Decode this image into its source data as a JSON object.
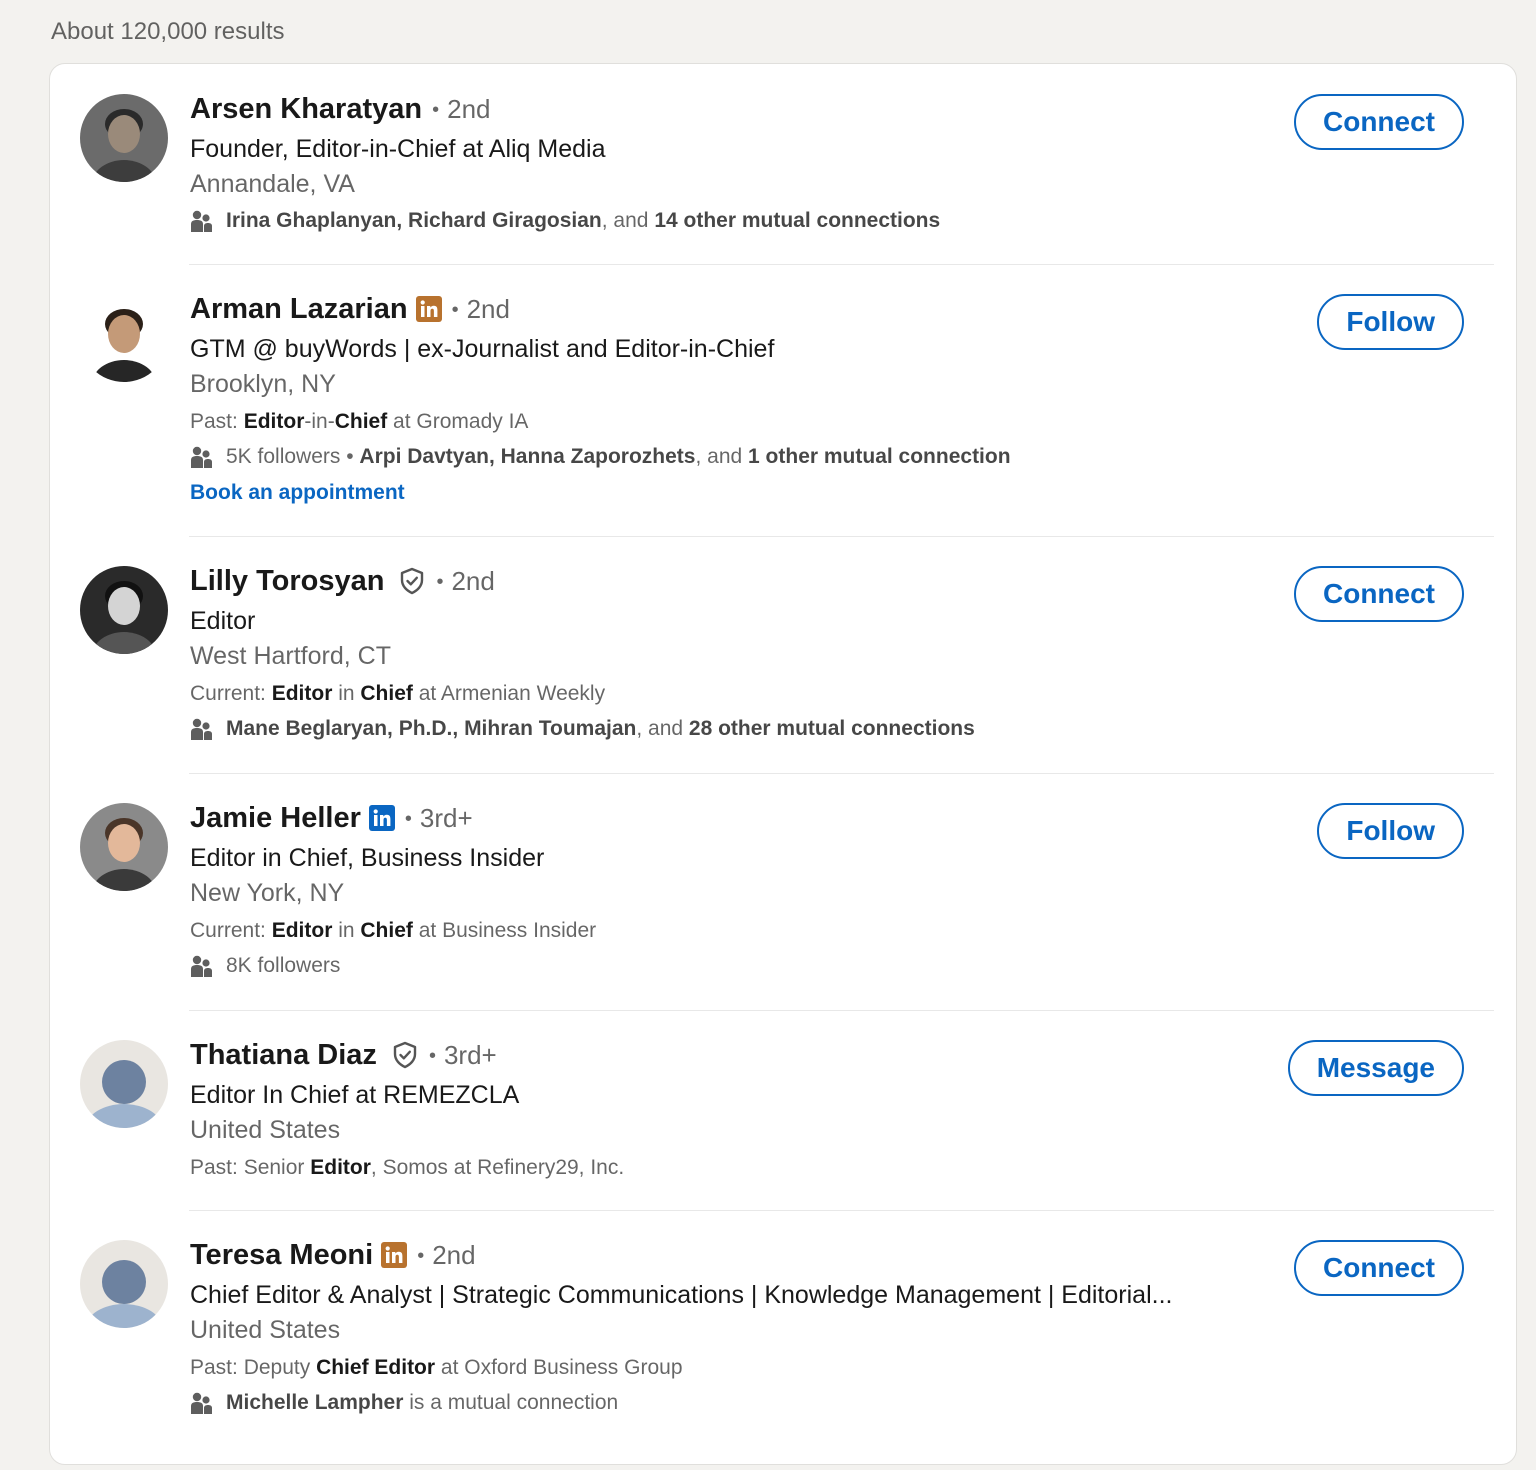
{
  "results_count": "About 120,000 results",
  "results": [
    {
      "name": "Arsen Kharatyan",
      "badge": "",
      "degree": "2nd",
      "headline": "Founder, Editor-in-Chief at Aliq Media",
      "location": "Annandale, VA",
      "summary": null,
      "mutual": {
        "followers": "",
        "names": "Irina Ghaplanyan, Richard Giragosian",
        "joiner": ", and ",
        "rest": "14 other mutual connections"
      },
      "link": "",
      "action": "Connect",
      "avatar": "photo"
    },
    {
      "name": "Arman Lazarian",
      "badge": "linkedin-orange",
      "degree": "2nd",
      "headline": "GTM @ buyWords | ex-Journalist and Editor-in-Chief",
      "location": "Brooklyn, NY",
      "summary": {
        "prefix": "Past: ",
        "parts": [
          [
            "Editor",
            true
          ],
          [
            "-in-",
            false
          ],
          [
            "Chief",
            true
          ],
          [
            " at Gromady IA",
            false
          ]
        ]
      },
      "mutual": {
        "followers": "5K followers",
        "names": "Arpi Davtyan, Hanna Zaporozhets",
        "joiner": ", and ",
        "rest": "1 other mutual connection"
      },
      "link": "Book an appointment",
      "action": "Follow",
      "avatar": "photo"
    },
    {
      "name": "Lilly Torosyan",
      "badge": "verified",
      "degree": "2nd",
      "headline": "Editor",
      "location": "West Hartford, CT",
      "summary": {
        "prefix": "Current: ",
        "parts": [
          [
            "Editor",
            true
          ],
          [
            " in ",
            false
          ],
          [
            "Chief",
            true
          ],
          [
            " at Armenian Weekly",
            false
          ]
        ]
      },
      "mutual": {
        "followers": "",
        "names": "Mane Beglaryan, Ph.D., Mihran Toumajan",
        "joiner": ", and ",
        "rest": "28 other mutual connections"
      },
      "link": "",
      "action": "Connect",
      "avatar": "photo"
    },
    {
      "name": "Jamie Heller",
      "badge": "linkedin-blue",
      "degree": "3rd+",
      "headline": "Editor in Chief, Business Insider",
      "location": "New York, NY",
      "summary": {
        "prefix": "Current: ",
        "parts": [
          [
            "Editor",
            true
          ],
          [
            " in ",
            false
          ],
          [
            "Chief",
            true
          ],
          [
            " at Business Insider",
            false
          ]
        ]
      },
      "mutual": {
        "followers": "8K followers",
        "names": "",
        "joiner": "",
        "rest": ""
      },
      "link": "",
      "action": "Follow",
      "avatar": "photo"
    },
    {
      "name": "Thatiana Diaz",
      "badge": "verified",
      "degree": "3rd+",
      "headline": "Editor In Chief at REMEZCLA",
      "location": "United States",
      "summary": {
        "prefix": "Past: Senior ",
        "parts": [
          [
            "Editor",
            true
          ],
          [
            ", Somos at Refinery29, Inc.",
            false
          ]
        ]
      },
      "mutual": null,
      "link": "",
      "action": "Message",
      "avatar": "placeholder"
    },
    {
      "name": "Teresa Meoni",
      "badge": "linkedin-orange",
      "degree": "2nd",
      "headline": "Chief Editor & Analyst | Strategic Communications | Knowledge Management | Editorial...",
      "location": "United States",
      "summary": {
        "prefix": "Past: Deputy ",
        "parts": [
          [
            "Chief Editor",
            true
          ],
          [
            " at Oxford Business Group",
            false
          ]
        ]
      },
      "mutual": {
        "followers": "",
        "names": "Michelle Lampher",
        "joiner": " is a mutual connection",
        "rest": ""
      },
      "link": "",
      "action": "Connect",
      "avatar": "placeholder"
    }
  ],
  "colors": {
    "accent": "#0a66c2",
    "premium_badge": "#b8722e",
    "background": "#f3f2ef"
  },
  "icons": [
    "linkedin-premium-icon",
    "verified-shield-icon",
    "mutual-connections-icon",
    "avatar-placeholder-icon"
  ]
}
